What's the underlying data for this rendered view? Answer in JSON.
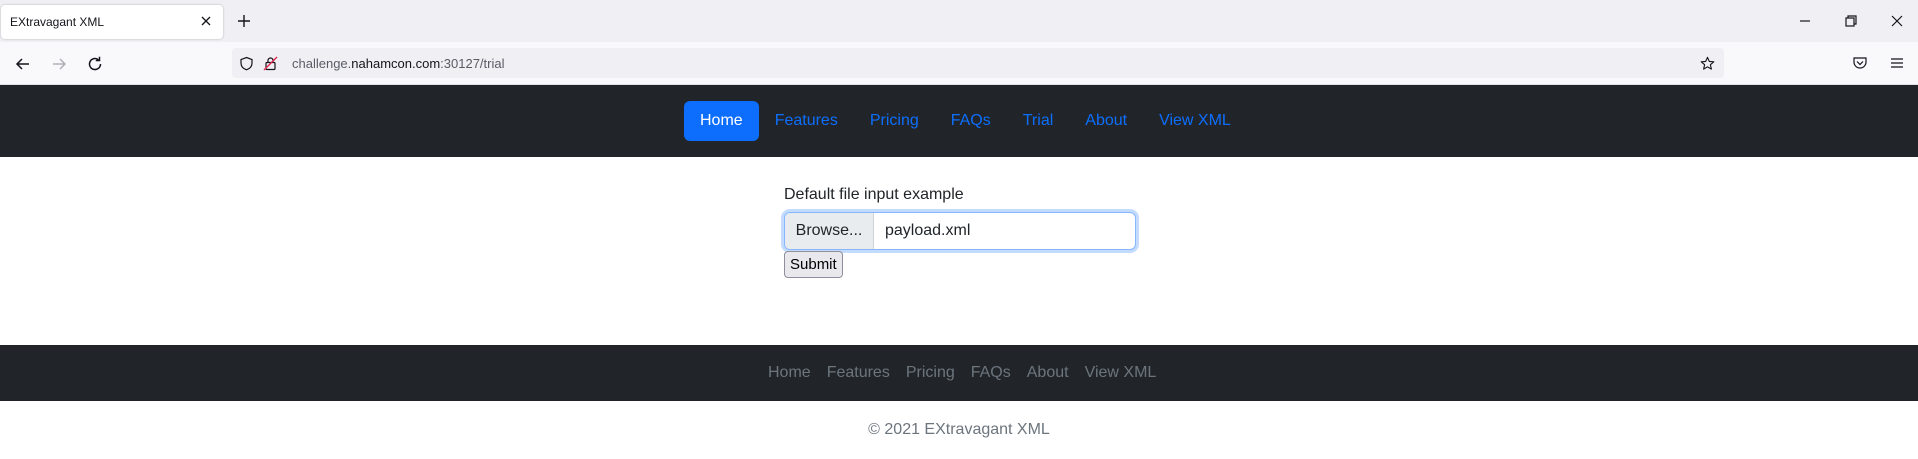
{
  "browser": {
    "tab_title": "EXtravagant XML",
    "url_prefix": "challenge.",
    "url_host": "nahamcon.com",
    "url_suffix": ":30127/trial"
  },
  "navbar": {
    "items": [
      {
        "label": "Home",
        "active": true
      },
      {
        "label": "Features"
      },
      {
        "label": "Pricing"
      },
      {
        "label": "FAQs"
      },
      {
        "label": "Trial"
      },
      {
        "label": "About"
      },
      {
        "label": "View XML"
      }
    ]
  },
  "form": {
    "label": "Default file input example",
    "browse_label": "Browse...",
    "file_name": "payload.xml",
    "submit_label": "Submit"
  },
  "footer": {
    "links": [
      "Home",
      "Features",
      "Pricing",
      "FAQs",
      "About",
      "View XML"
    ],
    "copyright": "© 2021 EXtravagant XML"
  },
  "colors": {
    "accent": "#0d6efd",
    "navbar_bg": "#212529",
    "footer_text": "#6c757d"
  },
  "icons": [
    "close-tab-icon",
    "new-tab-icon",
    "minimize-icon",
    "restore-icon",
    "close-window-icon",
    "back-icon",
    "forward-icon",
    "reload-icon",
    "shield-icon",
    "insecure-lock-icon",
    "bookmark-star-icon",
    "pocket-icon",
    "menu-icon"
  ]
}
